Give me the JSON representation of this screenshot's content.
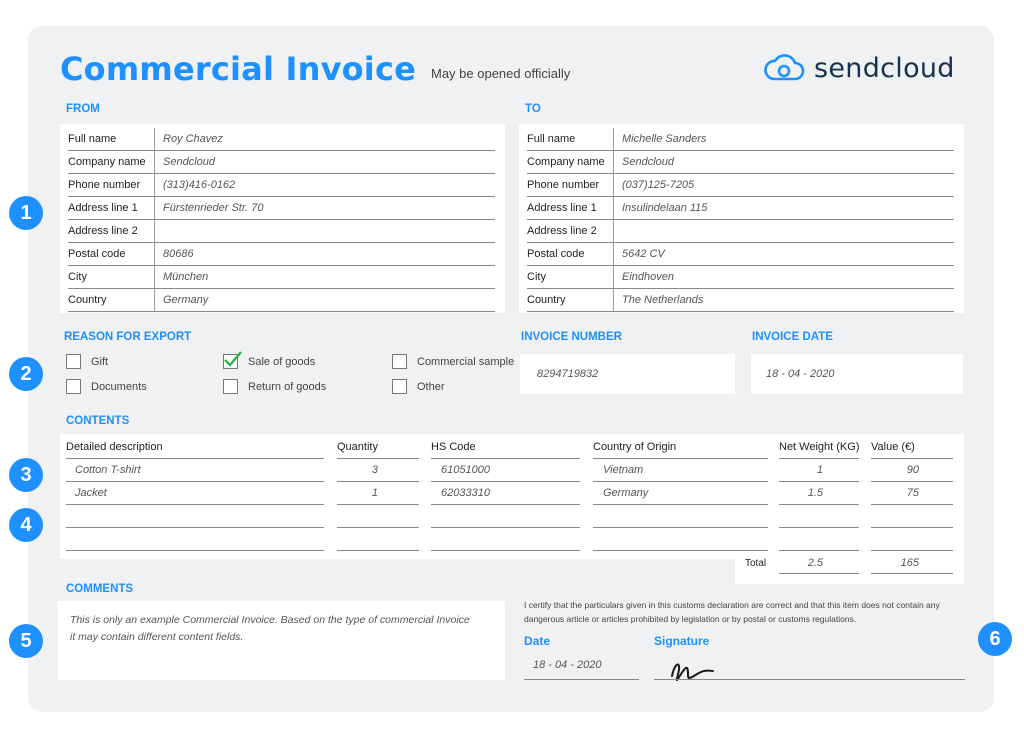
{
  "header": {
    "title": "Commercial Invoice",
    "subtitle": "May be opened officially",
    "brand": "sendcloud"
  },
  "from": {
    "heading": "FROM",
    "fields": [
      {
        "label": "Full name",
        "value": "Roy Chavez"
      },
      {
        "label": "Company name",
        "value": "Sendcloud"
      },
      {
        "label": "Phone number",
        "value": "(313)416-0162"
      },
      {
        "label": "Address line 1",
        "value": "Fürstenrieder Str. 70"
      },
      {
        "label": "Address line 2",
        "value": ""
      },
      {
        "label": "Postal code",
        "value": "80686"
      },
      {
        "label": "City",
        "value": "München"
      },
      {
        "label": "Country",
        "value": "Germany"
      }
    ]
  },
  "to": {
    "heading": "TO",
    "fields": [
      {
        "label": "Full name",
        "value": "Michelle Sanders"
      },
      {
        "label": "Company name",
        "value": "Sendcloud"
      },
      {
        "label": "Phone number",
        "value": "(037)125-7205"
      },
      {
        "label": "Address line 1",
        "value": "Insulindelaan 115"
      },
      {
        "label": "Address line 2",
        "value": ""
      },
      {
        "label": "Postal code",
        "value": "5642 CV"
      },
      {
        "label": "City",
        "value": "Eindhoven"
      },
      {
        "label": "Country",
        "value": "The Netherlands"
      }
    ]
  },
  "reason": {
    "heading": "REASON FOR EXPORT",
    "options": [
      {
        "label": "Gift",
        "checked": false
      },
      {
        "label": "Documents",
        "checked": false
      },
      {
        "label": "Sale of goods",
        "checked": true
      },
      {
        "label": "Return of goods",
        "checked": false
      },
      {
        "label": "Commercial sample",
        "checked": false
      },
      {
        "label": "Other",
        "checked": false
      }
    ]
  },
  "invoice": {
    "number_heading": "INVOICE NUMBER",
    "number": "8294719832",
    "date_heading": "INVOICE DATE",
    "date": "18 - 04 - 2020"
  },
  "contents": {
    "heading": "CONTENTS",
    "columns": [
      "Detailed description",
      "Quantity",
      "HS Code",
      "Country of Origin",
      "Net Weight (KG)",
      "Value (€)"
    ],
    "rows": [
      [
        "Cotton T-shirt",
        "3",
        "61051000",
        "Vietnam",
        "1",
        "90"
      ],
      [
        "Jacket",
        "1",
        "62033310",
        "Germany",
        "1.5",
        "75"
      ]
    ],
    "total_label": "Total",
    "total_weight": "2.5",
    "total_value": "165"
  },
  "comments": {
    "heading": "COMMENTS",
    "text": "This is only an example Commercial Invoice. Based on the type of commercial Invoice it may contain different content fields."
  },
  "certification": {
    "text": "I certify that the particulars given in this customs declaration are correct and that this item does not contain any dangerous article or articles prohibited by legislation or by postal or customs regulations.",
    "date_label": "Date",
    "date": "18 - 04 - 2020",
    "signature_label": "Signature"
  },
  "badges": [
    "1",
    "2",
    "3",
    "4",
    "5",
    "6"
  ],
  "colors": {
    "accent": "#1e90ff",
    "brand_text": "#16324f",
    "sheet": "#f0f1f2",
    "check": "#2db34a"
  }
}
